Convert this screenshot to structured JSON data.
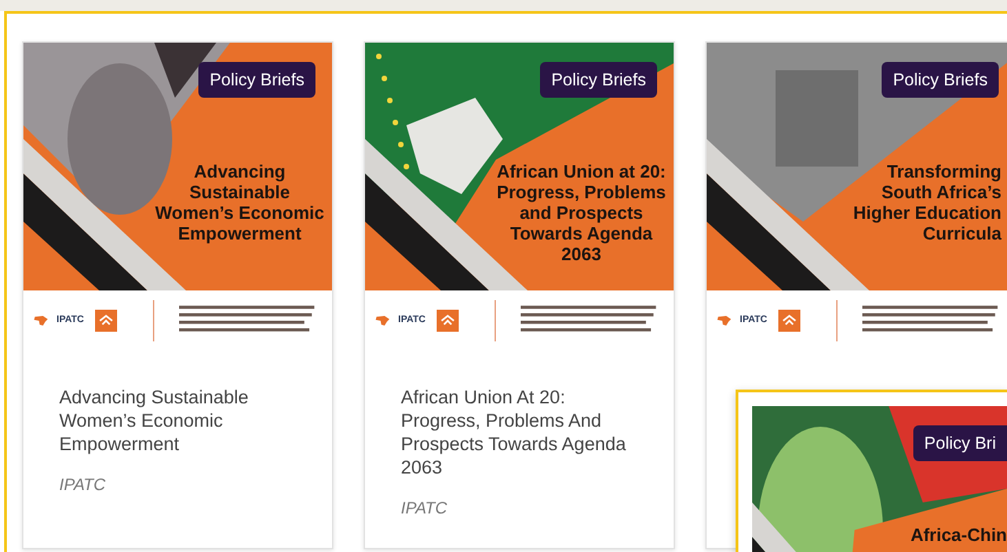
{
  "cards": [
    {
      "kind": "portrait",
      "badge": "Policy Briefs",
      "cover_title": "Advancing Sustainable Women’s Economic Empowerment",
      "logo_text": "IPATC",
      "title": "Advancing Sustainable Women’s Economic Empowerment",
      "publisher": "IPATC"
    },
    {
      "kind": "union",
      "badge": "Policy Briefs",
      "cover_title": "African Union at 20: Progress, Problems and Prospects Towards Agenda 2063",
      "logo_text": "IPATC",
      "title": "African Union At 20: Progress, Problems And Prospects Towards Agenda 2063",
      "publisher": "IPATC"
    },
    {
      "kind": "campus",
      "badge": "Policy Briefs",
      "cover_title": "Transforming South Africa’s Higher Education Curricula",
      "logo_text": "IPATC"
    }
  ],
  "floating_card": {
    "kind": "china",
    "badge": "Policy Bri",
    "cover_title": "Africa-Chin"
  }
}
